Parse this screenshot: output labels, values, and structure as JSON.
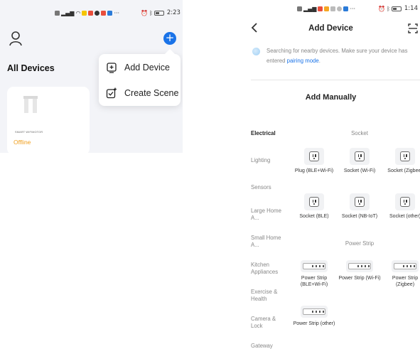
{
  "left_screen": {
    "status_bar": {
      "time": "2:23",
      "overflow": "···"
    },
    "header": {
      "user_icon": "user-icon",
      "add_icon": "plus-circle-icon",
      "add_glyph": "+"
    },
    "title": "All Devices",
    "device_card": {
      "name": "SMART WIFIMOTOR",
      "status": "Offline"
    },
    "popup_menu": {
      "items": [
        {
          "label": "Add Device",
          "icon": "add-device-icon"
        },
        {
          "label": "Create Scene",
          "icon": "create-scene-icon"
        }
      ]
    }
  },
  "right_screen": {
    "status_bar": {
      "time": "1:14",
      "overflow": "···"
    },
    "header": {
      "title": "Add Device",
      "back_icon": "chevron-left-icon",
      "scan_icon": "scan-icon"
    },
    "search_notice": {
      "text": "Searching for nearby devices. Make sure your device has entered ",
      "link": "pairing mode",
      "suffix": "."
    },
    "section_heading": "Add Manually",
    "categories": [
      {
        "label": "Electrical",
        "active": true
      },
      {
        "label": "Lighting",
        "active": false
      },
      {
        "label": "Sensors",
        "active": false
      },
      {
        "label": "Large Home A...",
        "active": false
      },
      {
        "label": "Small Home A...",
        "active": false
      },
      {
        "label": "Kitchen Appliances",
        "active": false
      },
      {
        "label": "Exercise & Health",
        "active": false
      },
      {
        "label": "Camera & Lock",
        "active": false
      },
      {
        "label": "Gateway",
        "active": false
      }
    ],
    "groups": [
      {
        "title": "Socket",
        "products": [
          {
            "name": "Plug (BLE+Wi-Fi)",
            "icon": "socket-icon"
          },
          {
            "name": "Socket (Wi-Fi)",
            "icon": "socket-icon"
          },
          {
            "name": "Socket (Zigbee)",
            "icon": "socket-icon"
          },
          {
            "name": "Socket (BLE)",
            "icon": "socket-icon"
          },
          {
            "name": "Socket (NB-IoT)",
            "icon": "socket-icon"
          },
          {
            "name": "Socket (other)",
            "icon": "socket-icon"
          }
        ]
      },
      {
        "title": "Power Strip",
        "products": [
          {
            "name": "Power Strip (BLE+Wi-Fi)",
            "icon": "power-strip-icon"
          },
          {
            "name": "Power Strip (Wi-Fi)",
            "icon": "power-strip-icon"
          },
          {
            "name": "Power Strip (Zigbee)",
            "icon": "power-strip-icon"
          },
          {
            "name": "Power Strip (other)",
            "icon": "power-strip-icon"
          }
        ]
      }
    ]
  },
  "colors": {
    "accent": "#1a73e8",
    "offline": "#f0a020",
    "background_left": "#f3f4f8"
  }
}
